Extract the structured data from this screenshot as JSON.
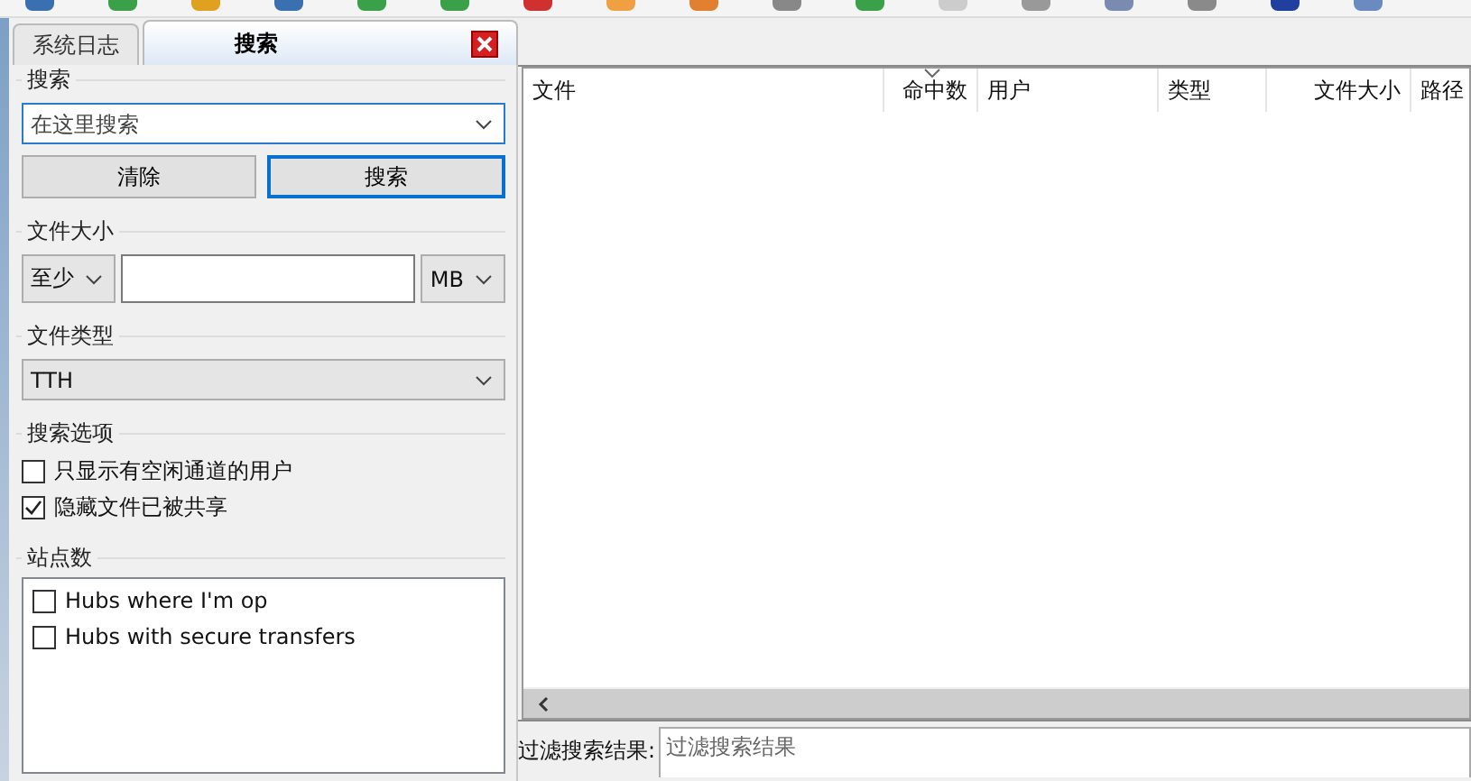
{
  "tabs": [
    {
      "label": "系统日志",
      "selected": false,
      "closable": false
    },
    {
      "label": "搜索",
      "selected": true,
      "closable": true
    }
  ],
  "search_group": {
    "label": "搜索",
    "query": {
      "placeholder": "在这里搜索"
    },
    "buttons": [
      {
        "label": "清除",
        "focused": false
      },
      {
        "label": "搜索",
        "focused": true
      }
    ]
  },
  "size_group": {
    "label": "文件大小",
    "mode": "至少",
    "unit": "MB"
  },
  "type_group": {
    "label": "文件类型",
    "value": "TTH"
  },
  "options_group": {
    "label": "搜索选项",
    "options": [
      {
        "label": "只显示有空闲通道的用户",
        "checked": false
      },
      {
        "label": "隐藏文件已被共享",
        "checked": true
      }
    ]
  },
  "hubs_group": {
    "label": "站点数",
    "hubs": [
      {
        "label": "Hubs where I'm op",
        "checked": false
      },
      {
        "label": "Hubs with secure transfers",
        "checked": false
      }
    ]
  },
  "results": {
    "columns": [
      {
        "label": "文件",
        "sorted": false
      },
      {
        "label": "命中数",
        "sorted": true
      },
      {
        "label": "用户",
        "sorted": false
      },
      {
        "label": "类型",
        "sorted": false
      },
      {
        "label": "文件大小",
        "sorted": false
      },
      {
        "label": "路径",
        "sorted": false
      }
    ]
  },
  "filter": {
    "label": "过滤搜索结果:",
    "placeholder": "过滤搜索结果"
  }
}
